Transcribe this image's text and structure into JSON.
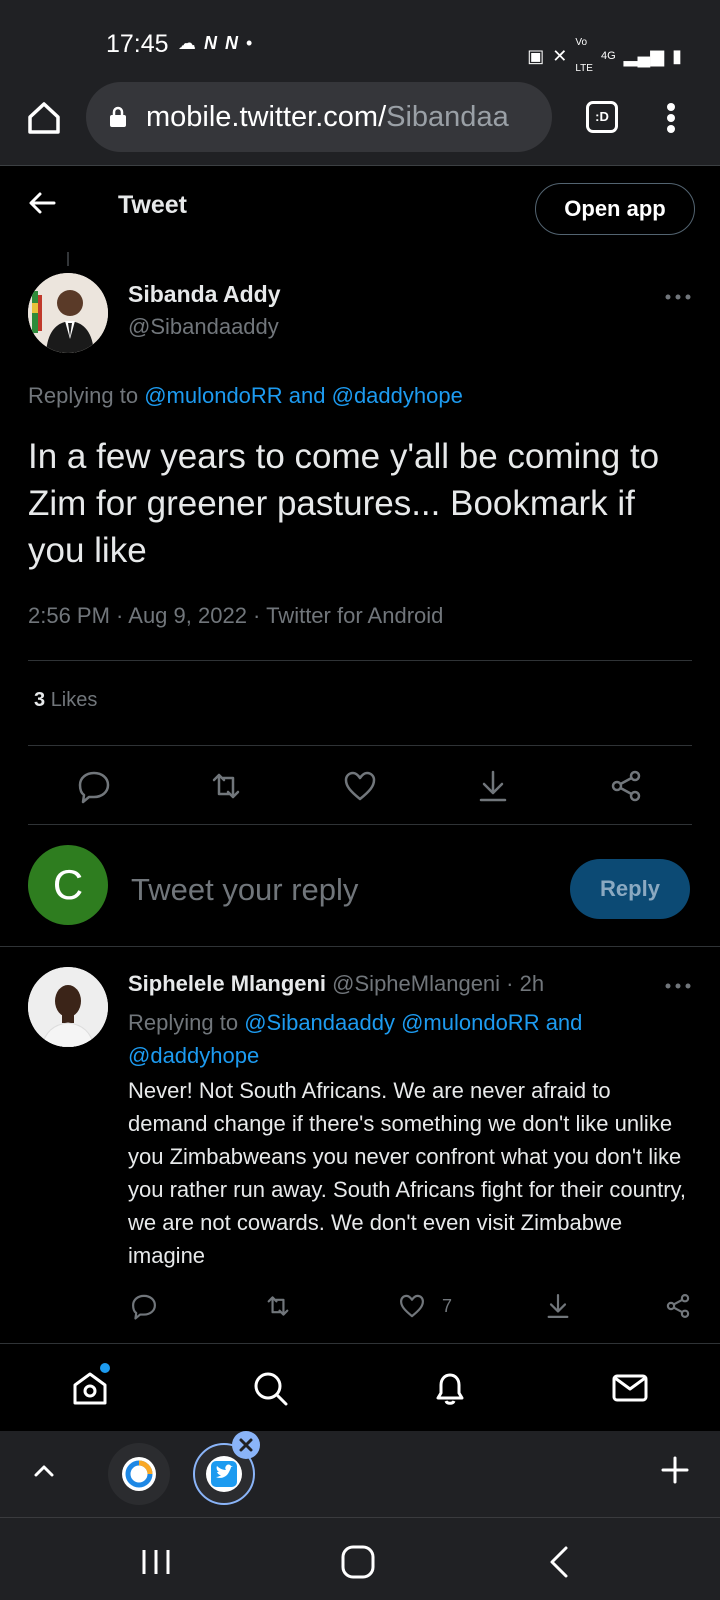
{
  "status_bar": {
    "time": "17:45"
  },
  "browser": {
    "url_host": "mobile.twitter.com/",
    "url_path": "Sibandaa",
    "tab_label": ":D"
  },
  "header": {
    "title": "Tweet",
    "open_app_label": "Open app"
  },
  "tweet": {
    "author_name": "Sibanda Addy",
    "author_handle": "@Sibandaaddy",
    "replying_prefix": "Replying to ",
    "replying_users": "@mulondoRR and @daddyhope",
    "text": "In a few years to come y'all be coming to Zim for greener pastures... Bookmark if you like",
    "meta": "2:56 PM · Aug 9, 2022 · Twitter for Android",
    "likes_count": "3",
    "likes_label": "Likes"
  },
  "compose": {
    "avatar_letter": "C",
    "placeholder": "Tweet your reply",
    "reply_label": "Reply"
  },
  "comment": {
    "author_name": "Siphelele Mlangeni",
    "author_handle_time": "@SipheMlangeni · 2h",
    "replying_prefix": "Replying to ",
    "replying_users_line1": "@Sibandaaddy @mulondoRR and",
    "replying_users_line2": "@daddyhope",
    "text": "Never! Not South Africans. We are never afraid to demand change if there's something we don't like unlike you Zimbabweans you never confront what you don't like you rather run away. South Africans fight for their country, we are not cowards. We don't even visit Zimbabwe imagine",
    "like_count": "7"
  },
  "colors": {
    "accent": "#1d9bf0",
    "text_secondary": "#71767b",
    "browser_chrome": "#202124",
    "compose_avatar": "#2e7d1f"
  },
  "icons": {
    "nav": [
      "home-icon",
      "search-icon",
      "notifications-icon",
      "messages-icon"
    ],
    "tweet_actions": [
      "reply-icon",
      "retweet-icon",
      "like-icon",
      "bookmark-icon",
      "share-icon"
    ]
  }
}
